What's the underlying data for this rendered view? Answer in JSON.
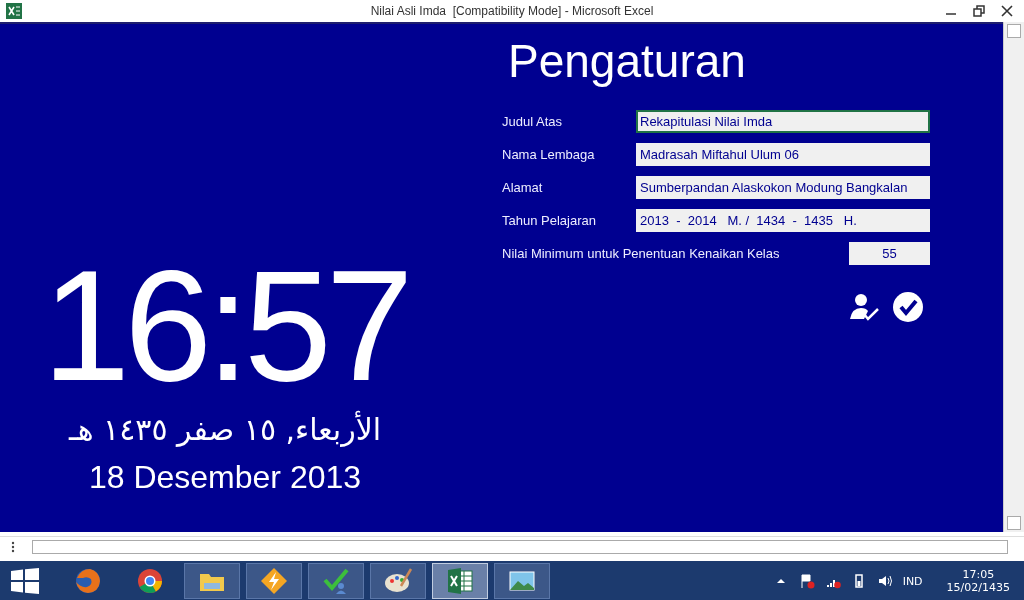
{
  "window": {
    "title": "Nilai Asli Imda  [Compatibility Mode] - Microsoft Excel"
  },
  "clock": {
    "time": "16:57",
    "hijri_date": "الأربعاء, ١٥ صفر ١٤٣٥ هـ",
    "date": "18 Desember 2013"
  },
  "settings": {
    "title": "Pengaturan",
    "fields": [
      {
        "kind": "text",
        "label": "Judul Atas",
        "value": "Rekapitulasi Nilai Imda",
        "selected": true
      },
      {
        "kind": "text",
        "label": "Nama Lembaga",
        "value": "Madrasah Miftahul Ulum 06",
        "selected": false
      },
      {
        "kind": "text",
        "label": "Alamat",
        "value": "Sumberpandan Alaskokon Modung Bangkalan",
        "selected": false
      },
      {
        "kind": "text",
        "label": "Tahun Pelajaran",
        "value": "2013  -  2014   M. /  1434  -  1435   H.",
        "selected": false
      },
      {
        "kind": "number",
        "label": "Nilai Minimum untuk Penentuan Kenaikan Kelas",
        "value": "55",
        "selected": false
      }
    ]
  },
  "taskbar": {
    "apps": [
      {
        "kind": "firefox",
        "selected": false
      },
      {
        "kind": "chrome",
        "selected": false
      },
      {
        "kind": "explorer",
        "selected": false
      },
      {
        "kind": "bolt",
        "selected": false
      },
      {
        "kind": "check",
        "selected": false
      },
      {
        "kind": "paint",
        "selected": false
      },
      {
        "kind": "excel",
        "selected": true
      },
      {
        "kind": "photo",
        "selected": false
      }
    ],
    "language": "IND",
    "time": "17:05",
    "date": "15/02/1435"
  }
}
